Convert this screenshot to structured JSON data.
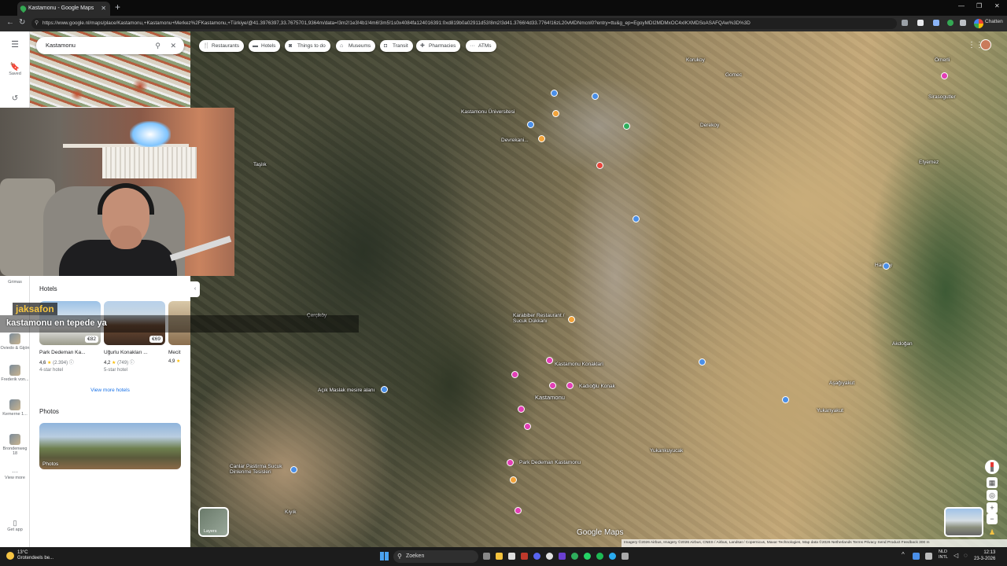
{
  "browser": {
    "tab_title": "Kastamonu - Google Maps",
    "url": "https://www.google.nl/maps/place/Kastamonu,+Kastamonu+Merkez%2FKastamonu,+Türkiye/@41.3976397,33.7675701,9364m/data=!3m2!1e3!4b1!4m6!3m5!1s0x4084fa124016391:0xd819b0a02911d53!8m2!3d41.3766!4d33.7764!16zL20vMDNmcnl0?entry=ttu&g_ep=EgoyMDI2MDMxOC4xIKXMDSoASAFQAw%3D%3D",
    "profile_label": "Chatten"
  },
  "search": {
    "value": "Kastamonu"
  },
  "rail": {
    "saved": "Saved",
    "items": [
      "Grimas",
      "Oviedo & Gijón",
      "Frederik von...",
      "Kemerne 1...",
      "Brondenweg 18",
      "View more"
    ],
    "get_app": "Get app"
  },
  "chips": [
    "Restaurants",
    "Hotels",
    "Things to do",
    "Museums",
    "Transit",
    "Pharmacies",
    "ATMs"
  ],
  "panel": {
    "hotels_title": "Hotels",
    "hotels": [
      {
        "name": "Park Dedeman Ka...",
        "price": "€82",
        "rating": "4,6",
        "reviews": "(2.394)",
        "kind": "4-star hotel"
      },
      {
        "name": "Uğurlu Konakları ...",
        "price": "€69",
        "rating": "4,2",
        "reviews": "(749)",
        "kind": "5-star hotel"
      },
      {
        "name": "Mecit",
        "price": "",
        "rating": "4,9",
        "reviews": "",
        "kind": ""
      }
    ],
    "view_more": "View more hotels",
    "photos_title": "Photos",
    "photos_label": "Photos"
  },
  "overlay": {
    "chat_user": "jaksafon",
    "chat_message": "kastamonu en tepede ya"
  },
  "map": {
    "labels": {
      "korukoy": "Korukoy",
      "gomec": "Gomec",
      "omerli": "Ömerli",
      "sirasogutler": "Sirasogutler",
      "derekoy": "Derekoy",
      "kastamonu_uni": "Kastamonu Üniversitesi",
      "devrekani": "Devrekani...",
      "taslik": "Taşlık",
      "etyemez": "Etyemez",
      "harikoy": "Hanköy",
      "cercikoy": "Çerçiköy",
      "karabiber": "Karabiber Restaurant / Sucuk Dükkanı",
      "akdogan": "Akdoğan",
      "asagiyakut": "Aşağıyakut",
      "yukariyakut": "Yukarıyakut",
      "kastamonu": "Kastamonu",
      "acikmaslak": "Açık Maslak mesire alanı",
      "yukarikuyucak": "Yukarıkuyucak",
      "canlar": "Canlar Pastirma Sucuk Dinlenme Tesisleri",
      "park_dedeman": "Park Dedeman Kastamonu",
      "kiyik": "Kıyık",
      "kadioglu": "Kadıoğlu Konak",
      "kastamonu_konaklari": "Kastamonu Konaklari"
    },
    "layers_label": "Layers",
    "logo": "Google Maps",
    "attribution": "Imagery ©2026 Airbus, Imagery ©2026 Airbus, CNES / Airbus, Landsat / Copernicus, Maxar Technologies, Map data ©2026   Netherlands   Terms   Privacy   Send Product Feedback   300 m"
  },
  "taskbar": {
    "temperature": "13°C",
    "weather_text": "Grotendeels be...",
    "search_placeholder": "Zoeken",
    "lang_line1": "NLD",
    "lang_line2": "INTL",
    "time": "12:13",
    "date": "23-3-2026"
  }
}
